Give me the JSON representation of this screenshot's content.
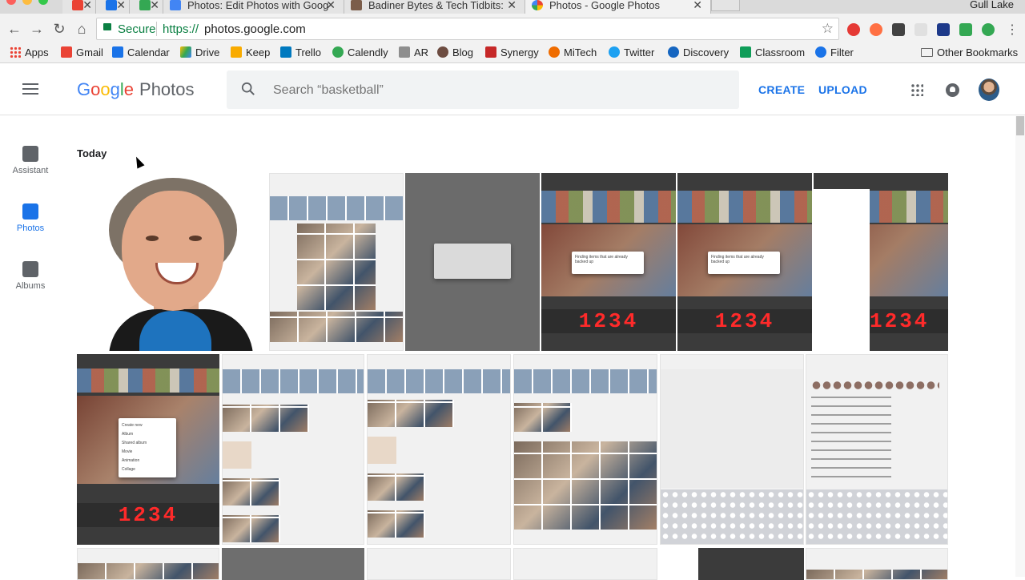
{
  "browser": {
    "tabs": [
      {
        "title": "",
        "favicon_color": "#ea4335"
      },
      {
        "title": "",
        "favicon_color": "#1a73e8"
      },
      {
        "title": "",
        "favicon_color": "#34a853"
      },
      {
        "title": "Photos: Edit Photos with Goog",
        "favicon_color": "#4285f4"
      },
      {
        "title": "Badiner Bytes & Tech Tidbits:",
        "favicon_color": "#7b5d4a"
      },
      {
        "title": "Photos - Google Photos",
        "favicon_color": "#fbbc05",
        "active": true
      }
    ],
    "profile_name": "Gull Lake",
    "secure_label": "Secure",
    "url_scheme": "https://",
    "url_host": "photos.google.com"
  },
  "bookmarks": [
    {
      "label": "Apps",
      "icon": "apps-grid-icon"
    },
    {
      "label": "Gmail",
      "icon": "gmail-icon",
      "color": "#ea4335"
    },
    {
      "label": "Calendar",
      "icon": "calendar-icon",
      "color": "#1a73e8"
    },
    {
      "label": "Drive",
      "icon": "drive-icon",
      "color": "#fbbc05"
    },
    {
      "label": "Keep",
      "icon": "keep-icon",
      "color": "#f9ab00"
    },
    {
      "label": "Trello",
      "icon": "trello-icon",
      "color": "#0079bf"
    },
    {
      "label": "Calendly",
      "icon": "calendly-icon",
      "color": "#34a853"
    },
    {
      "label": "AR",
      "icon": "ar-icon",
      "color": "#8e8e8e"
    },
    {
      "label": "Blog",
      "icon": "blog-icon",
      "color": "#6d4c41"
    },
    {
      "label": "Synergy",
      "icon": "synergy-icon",
      "color": "#c62828"
    },
    {
      "label": "MiTech",
      "icon": "mitech-icon",
      "color": "#ef6c00"
    },
    {
      "label": "Twitter",
      "icon": "twitter-icon",
      "color": "#1da1f2"
    },
    {
      "label": "Discovery",
      "icon": "discovery-icon",
      "color": "#1565c0"
    },
    {
      "label": "Classroom",
      "icon": "classroom-icon",
      "color": "#0f9d58"
    },
    {
      "label": "Filter",
      "icon": "filter-icon",
      "color": "#1a73e8"
    }
  ],
  "other_bookmarks": "Other Bookmarks",
  "header": {
    "logo_letters": [
      "G",
      "o",
      "o",
      "g",
      "l",
      "e"
    ],
    "product": "Photos",
    "search_placeholder": "Search “basketball”",
    "create_label": "CREATE",
    "upload_label": "UPLOAD",
    "accent_color": "#1a73e8"
  },
  "sidebar": {
    "items": [
      {
        "label": "Assistant",
        "icon": "assistant-icon"
      },
      {
        "label": "Photos",
        "icon": "photos-icon",
        "active": true
      },
      {
        "label": "Albums",
        "icon": "albums-icon"
      }
    ]
  },
  "main": {
    "section_title": "Today",
    "dialog_text": "Finding items that are already backed up",
    "counter_digits": "1234",
    "create_menu": [
      "Create new",
      "Album",
      "Shared album",
      "Movie",
      "Animation",
      "Collage"
    ]
  }
}
